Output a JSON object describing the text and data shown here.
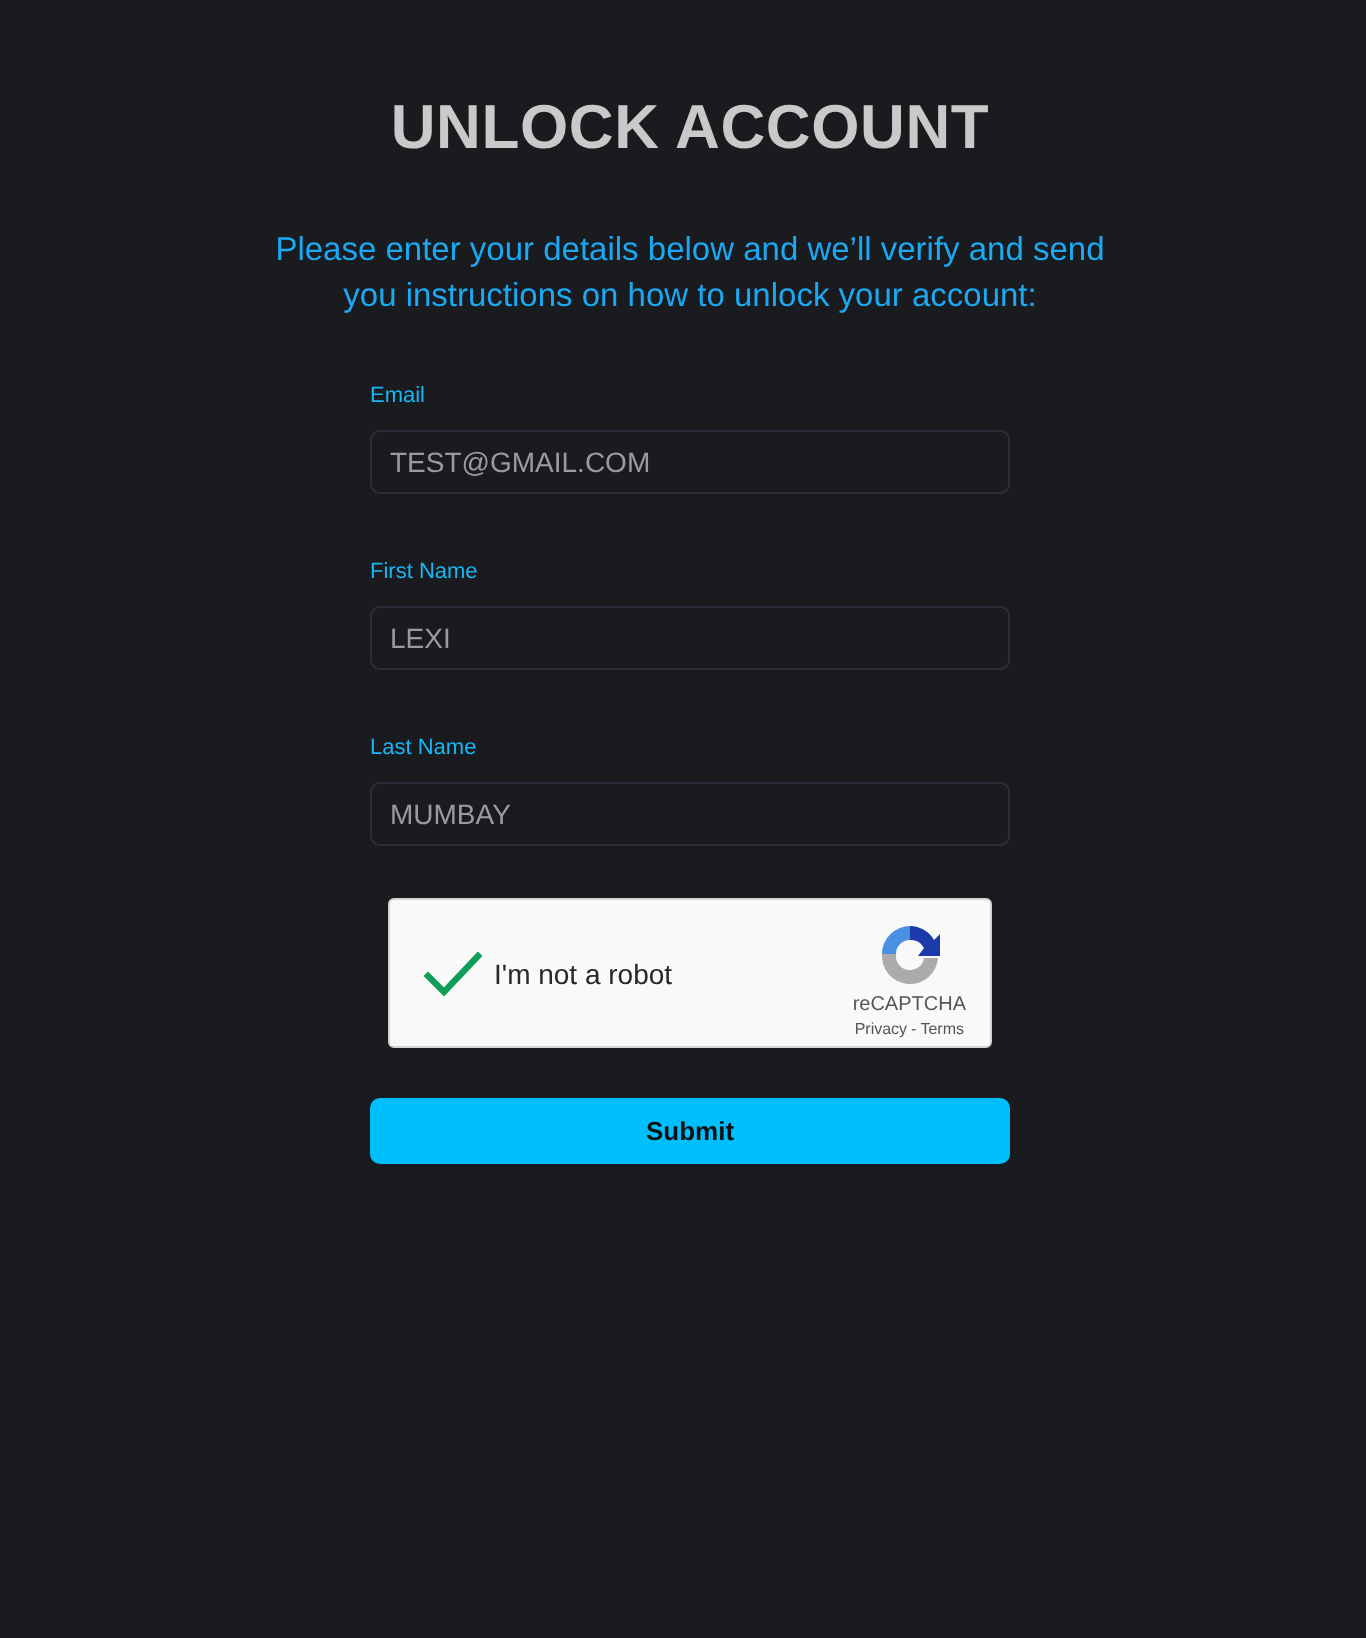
{
  "page": {
    "title": "UNLOCK ACCOUNT",
    "intro": "Please enter your details below and we’ll verify and send you instructions on how to unlock your account:"
  },
  "fields": [
    {
      "label": "Email",
      "value": "TEST@GMAIL.COM"
    },
    {
      "label": "First Name",
      "value": "LEXI"
    },
    {
      "label": "Last Name",
      "value": "MUMBAY"
    }
  ],
  "captcha": {
    "label": "I'm not a robot",
    "checked": true,
    "brand": "reCAPTCHA",
    "links": [
      "Privacy",
      "Terms"
    ],
    "separator": "-"
  },
  "submit": {
    "label": "Submit"
  }
}
